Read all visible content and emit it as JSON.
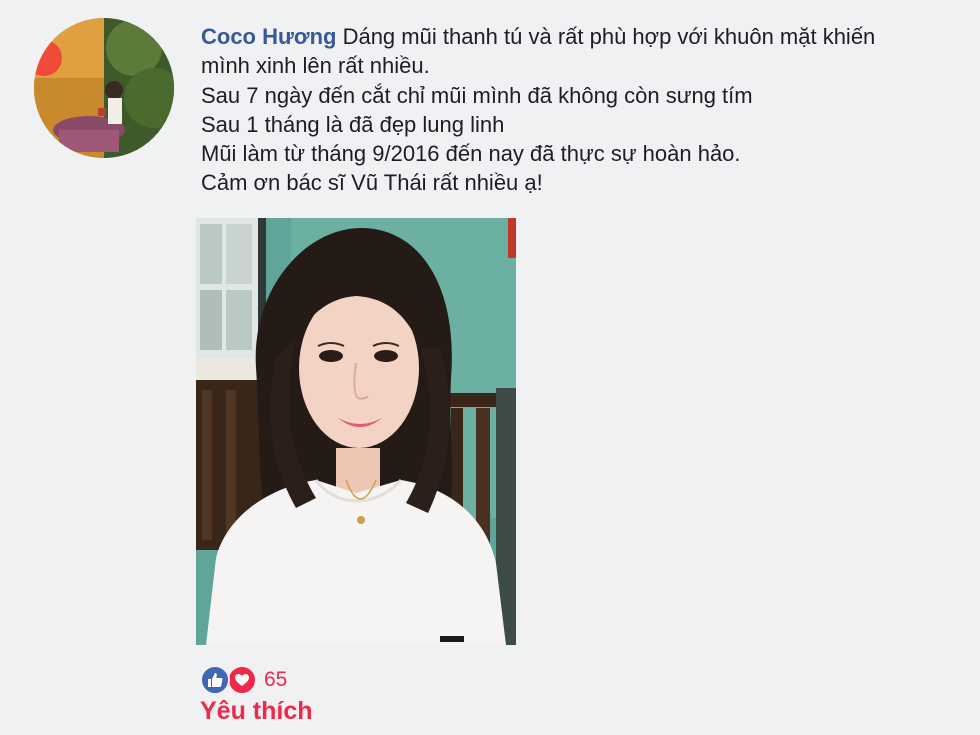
{
  "comment": {
    "author": "Coco Hương",
    "lines": [
      "Dáng mũi thanh tú và rất phù hợp với khuôn mặt khiến",
      "mình xinh lên rất nhiều.",
      "Sau 7 ngày đến cắt chỉ mũi mình đã không còn sưng tím",
      "Sau 1 tháng là đã đẹp lung linh",
      "Mũi làm từ tháng 9/2016 đến nay đã thực sự hoàn hảo.",
      "Cảm ơn bác sĩ Vũ Thái rất nhiều ạ!"
    ]
  },
  "reactions": {
    "icons": [
      "like-icon",
      "love-icon"
    ],
    "count": "65",
    "label": "Yêu thích"
  },
  "colors": {
    "author": "#385898",
    "like": "#4267b2",
    "love": "#f0284a",
    "background": "#f0f1f3"
  }
}
